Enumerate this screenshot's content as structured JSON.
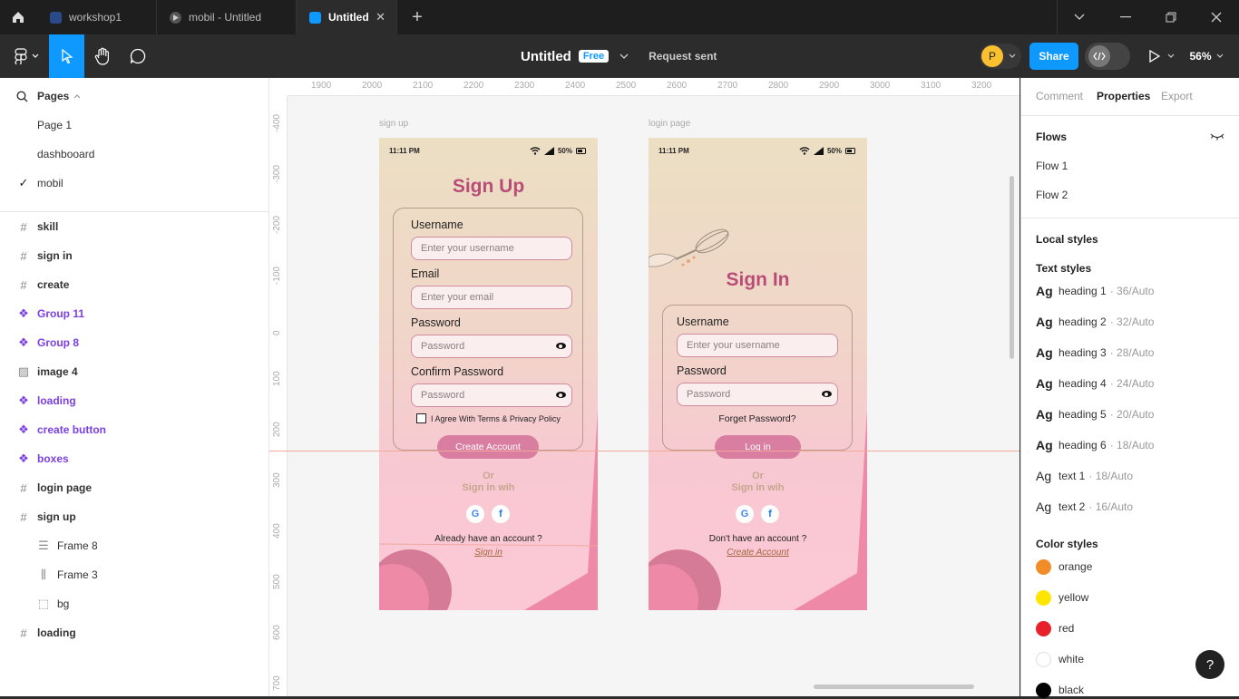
{
  "tabs": [
    {
      "label": "workshop1",
      "icon": "figma-file-icon"
    },
    {
      "label": "mobil - Untitled",
      "icon": "prototype-play-icon"
    },
    {
      "label": "Untitled",
      "icon": "figma-file-icon",
      "active": true
    }
  ],
  "toolbar": {
    "file_title": "Untitled",
    "plan_badge": "Free",
    "request_status": "Request sent",
    "avatar_initial": "P",
    "share_label": "Share",
    "zoom": "56%"
  },
  "left_panel": {
    "pages_label": "Pages",
    "pages": [
      {
        "label": "Page 1",
        "checked": false
      },
      {
        "label": "dashbooard",
        "checked": false
      },
      {
        "label": "mobil",
        "checked": true
      }
    ],
    "layers": [
      {
        "label": "skill",
        "type": "frame"
      },
      {
        "label": "sign in",
        "type": "frame"
      },
      {
        "label": "create",
        "type": "frame"
      },
      {
        "label": "Group 11",
        "type": "component"
      },
      {
        "label": "Group 8",
        "type": "component"
      },
      {
        "label": "image 4",
        "type": "image"
      },
      {
        "label": "loading",
        "type": "component"
      },
      {
        "label": "create button",
        "type": "component"
      },
      {
        "label": "boxes",
        "type": "component"
      },
      {
        "label": "login page",
        "type": "frame"
      },
      {
        "label": "sign up",
        "type": "frame"
      },
      {
        "label": "Frame 8",
        "type": "auto-layout-v",
        "indent": true
      },
      {
        "label": "Frame 3",
        "type": "auto-layout-h",
        "indent": true
      },
      {
        "label": "bg",
        "type": "rect-dashed",
        "indent": true
      },
      {
        "label": "loading",
        "type": "frame"
      }
    ]
  },
  "right_panel": {
    "tabs": [
      "Comment",
      "Properties",
      "Export"
    ],
    "active_tab": "Properties",
    "flows_label": "Flows",
    "flows": [
      "Flow 1",
      "Flow 2"
    ],
    "local_styles_label": "Local styles",
    "text_styles_label": "Text styles",
    "text_styles": [
      {
        "ag": "Ag",
        "name": "heading 1",
        "meta": "· 36/Auto",
        "bold": true
      },
      {
        "ag": "Ag",
        "name": "heading 2",
        "meta": "· 32/Auto",
        "bold": true
      },
      {
        "ag": "Ag",
        "name": "heading 3",
        "meta": "· 28/Auto",
        "bold": true
      },
      {
        "ag": "Ag",
        "name": "heading 4",
        "meta": "· 24/Auto",
        "bold": true
      },
      {
        "ag": "Ag",
        "name": "heading 5",
        "meta": "· 20/Auto",
        "bold": true
      },
      {
        "ag": "Ag",
        "name": "heading 6",
        "meta": "· 18/Auto",
        "bold": true
      },
      {
        "ag": "Ag",
        "name": "text 1",
        "meta": "· 18/Auto",
        "bold": false
      },
      {
        "ag": "Ag",
        "name": "text 2",
        "meta": "· 16/Auto",
        "bold": false
      }
    ],
    "color_styles_label": "Color styles",
    "color_styles": [
      {
        "name": "orange",
        "color": "#f28c28"
      },
      {
        "name": "yellow",
        "color": "#ffe500"
      },
      {
        "name": "red",
        "color": "#e8202a"
      },
      {
        "name": "white",
        "color": "#ffffff"
      },
      {
        "name": "black",
        "color": "#000000"
      }
    ],
    "help_label": "?"
  },
  "canvas": {
    "ruler_x": [
      "1900",
      "2000",
      "2100",
      "2200",
      "2300",
      "2400",
      "2500",
      "2600",
      "2700",
      "2800",
      "2900",
      "3000",
      "3100",
      "3200"
    ],
    "ruler_y": [
      "-400",
      "-300",
      "-200",
      "-100",
      "0",
      "100",
      "200",
      "300",
      "400",
      "500",
      "600",
      "700"
    ],
    "frames": [
      {
        "label": "sign up",
        "status_time": "11:11 PM",
        "battery": "50%",
        "title": "Sign Up",
        "fields": [
          {
            "label": "Username",
            "placeholder": "Enter your username",
            "eye": false
          },
          {
            "label": "Email",
            "placeholder": "Enter your email",
            "eye": false
          },
          {
            "label": "Password",
            "placeholder": "Password",
            "eye": true
          },
          {
            "label": "Confirm Password",
            "placeholder": "Password",
            "eye": true
          }
        ],
        "checkbox_label": "I Agree With Terms & Privacy Policy",
        "button": "Create Account",
        "or": "Or",
        "sign_in_with": "Sign in wih",
        "footer": "Already have an account ?",
        "footer_link": "Sign in"
      },
      {
        "label": "login page",
        "status_time": "11:11 PM",
        "battery": "50%",
        "title": "Sign In",
        "fields": [
          {
            "label": "Username",
            "placeholder": "Enter your username",
            "eye": false
          },
          {
            "label": "Password",
            "placeholder": "Password",
            "eye": true
          }
        ],
        "forget_label": "Forget Password?",
        "button": "Log in",
        "or": "Or",
        "sign_in_with": "Sign in wih",
        "footer": "Don't have an account ?",
        "footer_link": "Create Account"
      }
    ]
  },
  "colors": {
    "accent_blue": "#0d99ff",
    "title_pink": "#b94d78",
    "button_pink": "#d97ea0",
    "component_purple": "#7b3fe4"
  }
}
